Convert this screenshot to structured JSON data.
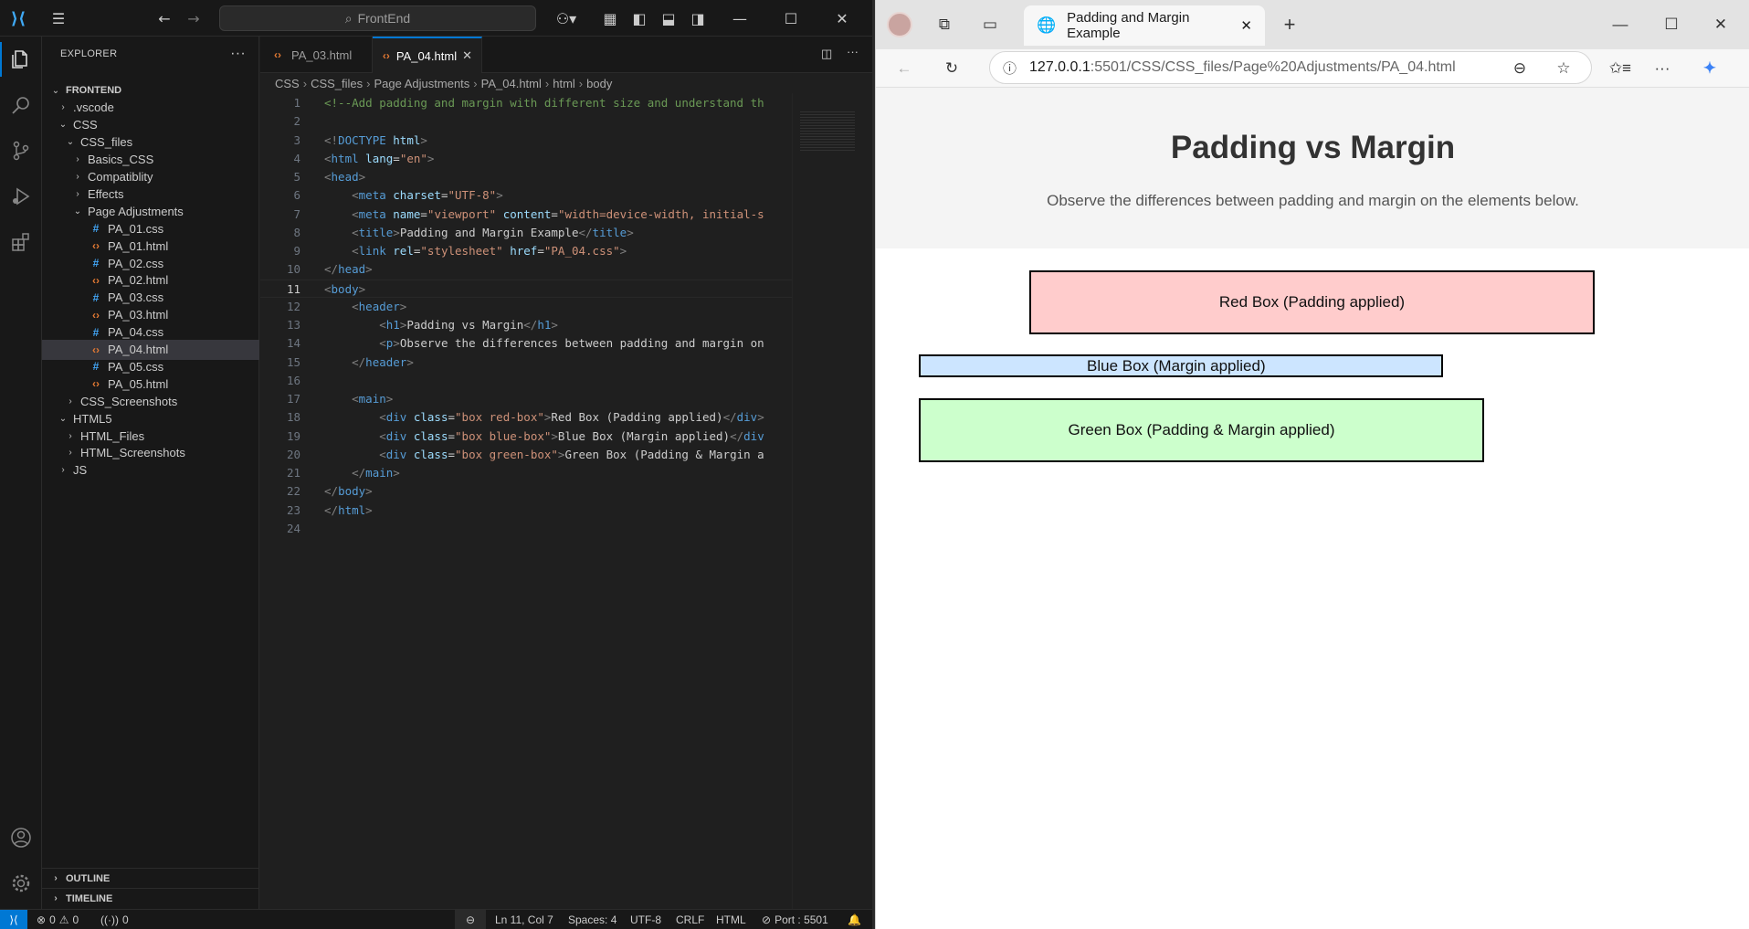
{
  "vscode": {
    "command_center": "FrontEnd",
    "explorer_title": "EXPLORER",
    "tree": [
      {
        "label": "FRONTEND",
        "depth": 0,
        "type": "folder-open",
        "bold": true
      },
      {
        "label": ".vscode",
        "depth": 1,
        "type": "folder"
      },
      {
        "label": "CSS",
        "depth": 1,
        "type": "folder-open"
      },
      {
        "label": "CSS_files",
        "depth": 2,
        "type": "folder-open"
      },
      {
        "label": "Basics_CSS",
        "depth": 3,
        "type": "folder"
      },
      {
        "label": "Compatiblity",
        "depth": 3,
        "type": "folder"
      },
      {
        "label": "Effects",
        "depth": 3,
        "type": "folder"
      },
      {
        "label": "Page Adjustments",
        "depth": 3,
        "type": "folder-open"
      },
      {
        "label": "PA_01.css",
        "depth": 4,
        "type": "css"
      },
      {
        "label": "PA_01.html",
        "depth": 4,
        "type": "html"
      },
      {
        "label": "PA_02.css",
        "depth": 4,
        "type": "css"
      },
      {
        "label": "PA_02.html",
        "depth": 4,
        "type": "html"
      },
      {
        "label": "PA_03.css",
        "depth": 4,
        "type": "css"
      },
      {
        "label": "PA_03.html",
        "depth": 4,
        "type": "html"
      },
      {
        "label": "PA_04.css",
        "depth": 4,
        "type": "css"
      },
      {
        "label": "PA_04.html",
        "depth": 4,
        "type": "html",
        "selected": true
      },
      {
        "label": "PA_05.css",
        "depth": 4,
        "type": "css"
      },
      {
        "label": "PA_05.html",
        "depth": 4,
        "type": "html"
      },
      {
        "label": "CSS_Screenshots",
        "depth": 2,
        "type": "folder"
      },
      {
        "label": "HTML5",
        "depth": 1,
        "type": "folder-open"
      },
      {
        "label": "HTML_Files",
        "depth": 2,
        "type": "folder"
      },
      {
        "label": "HTML_Screenshots",
        "depth": 2,
        "type": "folder"
      },
      {
        "label": "JS",
        "depth": 1,
        "type": "folder"
      }
    ],
    "outline_label": "OUTLINE",
    "timeline_label": "TIMELINE",
    "tabs": [
      {
        "label": "PA_03.html",
        "active": false
      },
      {
        "label": "PA_04.html",
        "active": true
      }
    ],
    "breadcrumb": [
      "CSS",
      "CSS_files",
      "Page Adjustments",
      "PA_04.html",
      "html",
      "body"
    ],
    "current_line": 11,
    "code_lines": [
      [
        [
          "c-com",
          "<!--Add padding and margin with different size and understand th"
        ]
      ],
      [],
      [
        [
          "c-brk",
          "<!"
        ],
        [
          "c-tag",
          "DOCTYPE"
        ],
        [
          "c-txt",
          " "
        ],
        [
          "c-attr",
          "html"
        ],
        [
          "c-brk",
          ">"
        ]
      ],
      [
        [
          "c-brk",
          "<"
        ],
        [
          "c-tag",
          "html"
        ],
        [
          "c-txt",
          " "
        ],
        [
          "c-attr",
          "lang"
        ],
        [
          "c-txt",
          "="
        ],
        [
          "c-str",
          "\"en\""
        ],
        [
          "c-brk",
          ">"
        ]
      ],
      [
        [
          "c-brk",
          "<"
        ],
        [
          "c-tag",
          "head"
        ],
        [
          "c-brk",
          ">"
        ]
      ],
      [
        [
          "c-txt",
          "    "
        ],
        [
          "c-brk",
          "<"
        ],
        [
          "c-tag",
          "meta"
        ],
        [
          "c-txt",
          " "
        ],
        [
          "c-attr",
          "charset"
        ],
        [
          "c-txt",
          "="
        ],
        [
          "c-str",
          "\"UTF-8\""
        ],
        [
          "c-brk",
          ">"
        ]
      ],
      [
        [
          "c-txt",
          "    "
        ],
        [
          "c-brk",
          "<"
        ],
        [
          "c-tag",
          "meta"
        ],
        [
          "c-txt",
          " "
        ],
        [
          "c-attr",
          "name"
        ],
        [
          "c-txt",
          "="
        ],
        [
          "c-str",
          "\"viewport\""
        ],
        [
          "c-txt",
          " "
        ],
        [
          "c-attr",
          "content"
        ],
        [
          "c-txt",
          "="
        ],
        [
          "c-str",
          "\"width=device-width, initial-s"
        ]
      ],
      [
        [
          "c-txt",
          "    "
        ],
        [
          "c-brk",
          "<"
        ],
        [
          "c-tag",
          "title"
        ],
        [
          "c-brk",
          ">"
        ],
        [
          "c-txt",
          "Padding and Margin Example"
        ],
        [
          "c-brk",
          "</"
        ],
        [
          "c-tag",
          "title"
        ],
        [
          "c-brk",
          ">"
        ]
      ],
      [
        [
          "c-txt",
          "    "
        ],
        [
          "c-brk",
          "<"
        ],
        [
          "c-tag",
          "link"
        ],
        [
          "c-txt",
          " "
        ],
        [
          "c-attr",
          "rel"
        ],
        [
          "c-txt",
          "="
        ],
        [
          "c-str",
          "\"stylesheet\""
        ],
        [
          "c-txt",
          " "
        ],
        [
          "c-attr",
          "href"
        ],
        [
          "c-txt",
          "="
        ],
        [
          "c-str",
          "\"PA_04.css\""
        ],
        [
          "c-brk",
          ">"
        ]
      ],
      [
        [
          "c-brk",
          "</"
        ],
        [
          "c-tag",
          "head"
        ],
        [
          "c-brk",
          ">"
        ]
      ],
      [
        [
          "c-brk",
          "<"
        ],
        [
          "c-tag",
          "body"
        ],
        [
          "c-brk",
          ">"
        ]
      ],
      [
        [
          "c-txt",
          "    "
        ],
        [
          "c-brk",
          "<"
        ],
        [
          "c-tag",
          "header"
        ],
        [
          "c-brk",
          ">"
        ]
      ],
      [
        [
          "c-txt",
          "        "
        ],
        [
          "c-brk",
          "<"
        ],
        [
          "c-tag",
          "h1"
        ],
        [
          "c-brk",
          ">"
        ],
        [
          "c-txt",
          "Padding vs Margin"
        ],
        [
          "c-brk",
          "</"
        ],
        [
          "c-tag",
          "h1"
        ],
        [
          "c-brk",
          ">"
        ]
      ],
      [
        [
          "c-txt",
          "        "
        ],
        [
          "c-brk",
          "<"
        ],
        [
          "c-tag",
          "p"
        ],
        [
          "c-brk",
          ">"
        ],
        [
          "c-txt",
          "Observe the differences between padding and margin on"
        ]
      ],
      [
        [
          "c-txt",
          "    "
        ],
        [
          "c-brk",
          "</"
        ],
        [
          "c-tag",
          "header"
        ],
        [
          "c-brk",
          ">"
        ]
      ],
      [],
      [
        [
          "c-txt",
          "    "
        ],
        [
          "c-brk",
          "<"
        ],
        [
          "c-tag",
          "main"
        ],
        [
          "c-brk",
          ">"
        ]
      ],
      [
        [
          "c-txt",
          "        "
        ],
        [
          "c-brk",
          "<"
        ],
        [
          "c-tag",
          "div"
        ],
        [
          "c-txt",
          " "
        ],
        [
          "c-attr",
          "class"
        ],
        [
          "c-txt",
          "="
        ],
        [
          "c-str",
          "\"box red-box\""
        ],
        [
          "c-brk",
          ">"
        ],
        [
          "c-txt",
          "Red Box (Padding applied)"
        ],
        [
          "c-brk",
          "</"
        ],
        [
          "c-tag",
          "div"
        ],
        [
          "c-brk",
          ">"
        ]
      ],
      [
        [
          "c-txt",
          "        "
        ],
        [
          "c-brk",
          "<"
        ],
        [
          "c-tag",
          "div"
        ],
        [
          "c-txt",
          " "
        ],
        [
          "c-attr",
          "class"
        ],
        [
          "c-txt",
          "="
        ],
        [
          "c-str",
          "\"box blue-box\""
        ],
        [
          "c-brk",
          ">"
        ],
        [
          "c-txt",
          "Blue Box (Margin applied)"
        ],
        [
          "c-brk",
          "</"
        ],
        [
          "c-tag",
          "div"
        ]
      ],
      [
        [
          "c-txt",
          "        "
        ],
        [
          "c-brk",
          "<"
        ],
        [
          "c-tag",
          "div"
        ],
        [
          "c-txt",
          " "
        ],
        [
          "c-attr",
          "class"
        ],
        [
          "c-txt",
          "="
        ],
        [
          "c-str",
          "\"box green-box\""
        ],
        [
          "c-brk",
          ">"
        ],
        [
          "c-txt",
          "Green Box (Padding & Margin a"
        ]
      ],
      [
        [
          "c-txt",
          "    "
        ],
        [
          "c-brk",
          "</"
        ],
        [
          "c-tag",
          "main"
        ],
        [
          "c-brk",
          ">"
        ]
      ],
      [
        [
          "c-brk",
          "</"
        ],
        [
          "c-tag",
          "body"
        ],
        [
          "c-brk",
          ">"
        ]
      ],
      [
        [
          "c-brk",
          "</"
        ],
        [
          "c-tag",
          "html"
        ],
        [
          "c-brk",
          ">"
        ]
      ],
      []
    ],
    "status": {
      "errors": "0",
      "warnings": "0",
      "ports": "0",
      "position": "Ln 11, Col 7",
      "spaces": "Spaces: 4",
      "encoding": "UTF-8",
      "eol": "CRLF",
      "language": "HTML",
      "live_server": "Port : 5501"
    }
  },
  "browser": {
    "tab_title": "Padding and Margin Example",
    "url_host": "127.0.0.1",
    "url_rest": ":5501/CSS/CSS_files/Page%20Adjustments/PA_04.html",
    "page": {
      "h1": "Padding vs Margin",
      "p": "Observe the differences between padding and margin on the elements below.",
      "red_box": "Red Box (Padding applied)",
      "blue_box": "Blue Box (Margin applied)",
      "green_box": "Green Box (Padding & Margin applied)"
    }
  },
  "colors": {
    "vscode_accent": "#0078d4",
    "red_box": "#ffcccc",
    "blue_box": "#cce5ff",
    "green_box": "#ccffcc"
  }
}
